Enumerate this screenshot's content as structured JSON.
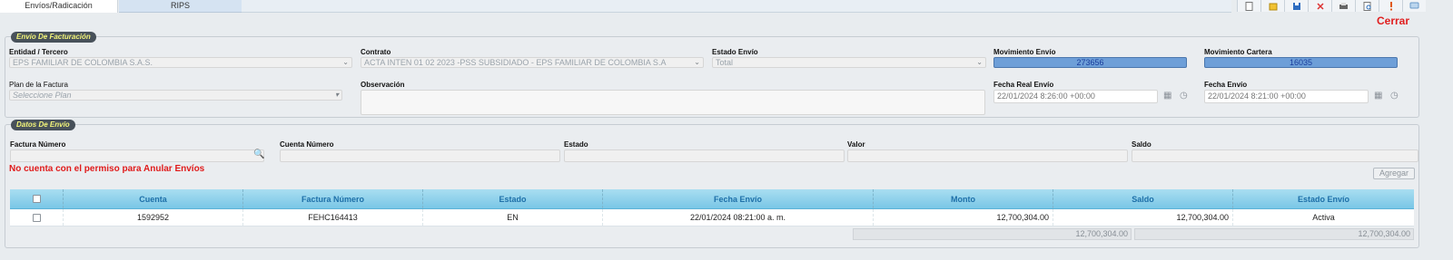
{
  "tabs": [
    {
      "label": "Envíos/Radicación"
    },
    {
      "label": "RIPS"
    }
  ],
  "toolbar": {
    "icons": [
      "new-document-icon",
      "folder-icon",
      "save-icon",
      "delete-icon",
      "print-icon",
      "preview-icon",
      "alert-icon",
      "chat-icon"
    ],
    "cerrar_label": "Cerrar"
  },
  "facturacion": {
    "legend": "Envío De Facturación",
    "entidad_label": "Entidad / Tercero",
    "entidad_value": "EPS FAMILIAR DE COLOMBIA S.A.S.",
    "contrato_label": "Contrato",
    "contrato_value": "ACTA INTEN 01 02 2023 -PSS SUBSIDIADO - EPS FAMILIAR DE COLOMBIA S.A",
    "estado_envio_label": "Estado Envío",
    "estado_envio_value": "Total",
    "mov_envio_label": "Movimiento Envío",
    "mov_envio_value": "273656",
    "mov_cartera_label": "Movimiento Cartera",
    "mov_cartera_value": "16035",
    "plan_label": "Plan de la Factura",
    "plan_placeholder": "Seleccione Plan",
    "observacion_label": "Observación",
    "fecha_real_label": "Fecha Real Envío",
    "fecha_real_value": "22/01/2024 8:26:00 +00:00",
    "fecha_envio_label": "Fecha Envío",
    "fecha_envio_value": "22/01/2024 8:21:00 +00:00"
  },
  "datos_envio": {
    "legend": "Datos De Envío",
    "factura_label": "Factura Número",
    "cuenta_label": "Cuenta Número",
    "estado_label": "Estado",
    "valor_label": "Valor",
    "saldo_label": "Saldo",
    "warning": "No cuenta con el permiso para Anular Envíos",
    "agregar_label": "Agregar"
  },
  "grid": {
    "columns": [
      "Cuenta",
      "Factura Número",
      "Estado",
      "Fecha Envío",
      "Monto",
      "Saldo",
      "Estado Envío"
    ],
    "rows": [
      {
        "cuenta": "1592952",
        "factura": "FEHC164413",
        "estado": "EN",
        "fecha": "22/01/2024 08:21:00 a. m.",
        "monto": "12,700,304.00",
        "saldo": "12,700,304.00",
        "estado_envio": "Activa"
      }
    ],
    "total_monto": "12,700,304.00",
    "total_saldo": "12,700,304.00"
  }
}
